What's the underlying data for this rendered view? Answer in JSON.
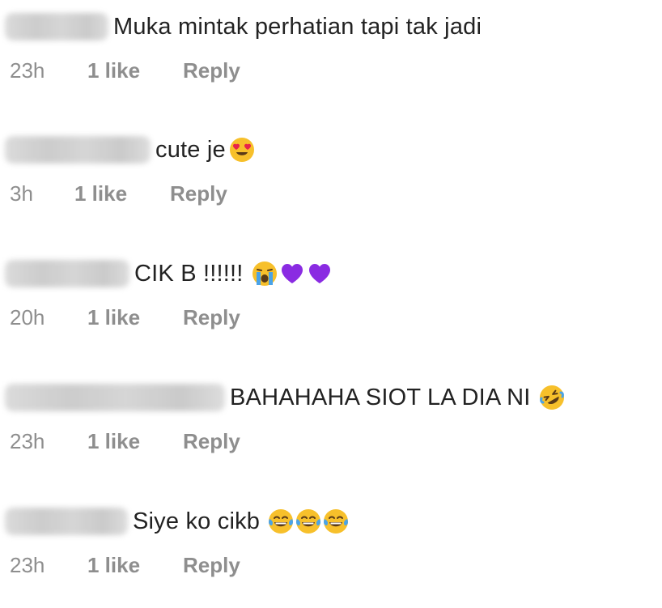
{
  "comments": [
    {
      "username": "",
      "text": "Muka mintak perhatian tapi tak jadi",
      "time": "23h",
      "likes": "1 like",
      "reply": "Reply",
      "emojis": []
    },
    {
      "username": "",
      "text": "cute je",
      "time": "3h",
      "likes": "1 like",
      "reply": "Reply",
      "emojis": [
        "heart-eyes-emoji-icon"
      ]
    },
    {
      "username": "",
      "text": "CIK B !!!!!!",
      "time": "20h",
      "likes": "1 like",
      "reply": "Reply",
      "emojis": [
        "loudly-crying-emoji-icon",
        "purple-heart-icon",
        "purple-heart-icon"
      ]
    },
    {
      "username": "",
      "text": "BAHAHAHA SIOT LA DIA NI",
      "time": "23h",
      "likes": "1 like",
      "reply": "Reply",
      "emojis": [
        "rolling-laughing-emoji-icon"
      ]
    },
    {
      "username": "",
      "text": "Siye ko cikb",
      "time": "23h",
      "likes": "1 like",
      "reply": "Reply",
      "emojis": [
        "tears-of-joy-emoji-icon",
        "tears-of-joy-emoji-icon",
        "tears-of-joy-emoji-icon"
      ]
    }
  ],
  "colors": {
    "meta_gray": "#8e8e8e",
    "text": "#222222",
    "purple_heart": "#8a2be2",
    "emoji_yellow": "#f7c02b"
  }
}
